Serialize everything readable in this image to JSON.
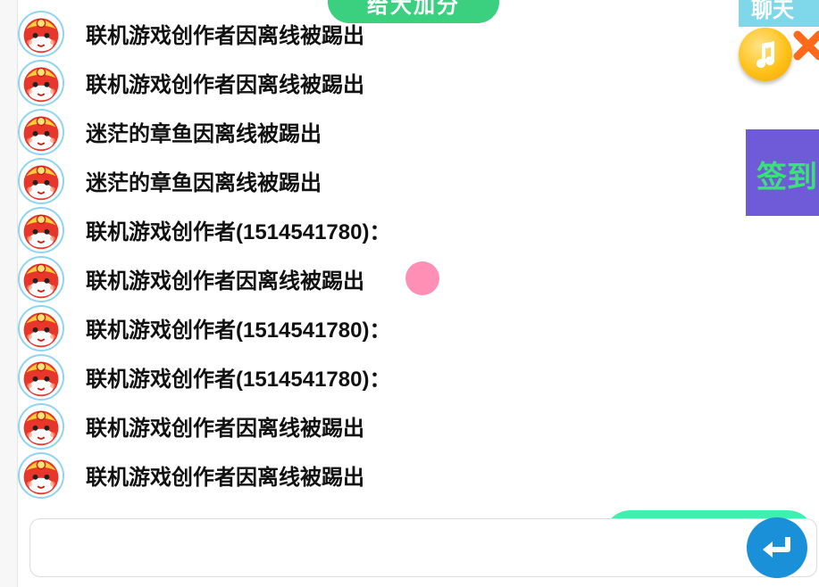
{
  "top_button": {
    "label": "给大加分"
  },
  "top_right_tab": {
    "label": "聊天"
  },
  "signin": {
    "label": "签到"
  },
  "music": {
    "icon": "music-note-icon"
  },
  "close": {
    "icon": "close-icon"
  },
  "chat": {
    "messages": [
      {
        "text": "联机游戏创作者因离线被踢出"
      },
      {
        "text": "联机游戏创作者因离线被踢出"
      },
      {
        "text": "迷茫的章鱼因离线被踢出"
      },
      {
        "text": "迷茫的章鱼因离线被踢出"
      },
      {
        "text": "联机游戏创作者(1514541780)："
      },
      {
        "text": "联机游戏创作者因离线被踢出"
      },
      {
        "text": "联机游戏创作者(1514541780)："
      },
      {
        "text": "联机游戏创作者(1514541780)："
      },
      {
        "text": "联机游戏创作者因离线被踢出"
      },
      {
        "text": "联机游戏创作者因离线被踢出"
      }
    ]
  },
  "input": {
    "value": "",
    "placeholder": ""
  },
  "send": {
    "icon": "enter-arrow-icon"
  },
  "colors": {
    "accent_green": "#3bd07f",
    "signin_bg": "#6f5bd8",
    "send_blue": "#1a90d9",
    "pink_dot": "#ff8fb5"
  }
}
